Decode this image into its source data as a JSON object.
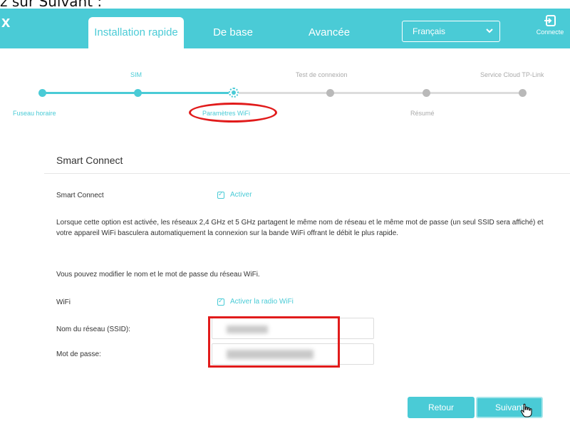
{
  "caption": "z sur Suivant :",
  "header": {
    "logo": "x",
    "tabs": [
      {
        "label": "Installation rapide",
        "active": true
      },
      {
        "label": "De base",
        "active": false
      },
      {
        "label": "Avancée",
        "active": false
      }
    ],
    "language": {
      "selected": "Français"
    },
    "connect_label": "Connecte",
    "colors": {
      "accent": "#4acbd6"
    }
  },
  "steps": [
    {
      "label": "Fuseau horaire",
      "state": "done"
    },
    {
      "label": "SIM",
      "state": "done"
    },
    {
      "label": "Paramètres WiFi",
      "state": "current"
    },
    {
      "label": "Test de connexion",
      "state": "todo"
    },
    {
      "label": "Résumé",
      "state": "todo"
    },
    {
      "label": "Service Cloud TP-Link",
      "state": "todo"
    }
  ],
  "section": {
    "title": "Smart Connect",
    "smart_connect_label": "Smart Connect",
    "smart_connect_checkbox": "Activer",
    "description": "Lorsque cette option est activée, les réseaux 2,4 GHz et 5 GHz partagent le même nom de réseau et le même mot de passe (un seul SSID sera affiché) et votre appareil WiFi basculera automatiquement la connexion sur la bande WiFi offrant le débit le plus rapide.",
    "hint": "Vous pouvez modifier le nom et le mot de passe du réseau WiFi.",
    "wifi_label": "WiFi",
    "wifi_checkbox": "Activer la radio WiFi",
    "ssid_label": "Nom du réseau (SSID):",
    "password_label": "Mot de passe:"
  },
  "buttons": {
    "back": "Retour",
    "next": "Suivant"
  }
}
